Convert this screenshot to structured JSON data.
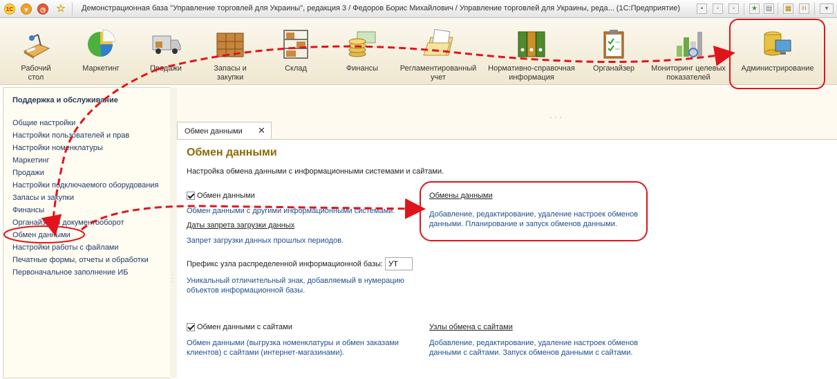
{
  "window": {
    "title": "Демонстрационная база \"Управление торговлей для Украины\", редакция 3 / Федоров Борис Михайлович / Управление торговлей для Украины, реда...  (1С:Предприятие)",
    "logo_text": "1С"
  },
  "sections": [
    {
      "label": "Рабочий\nстол",
      "icon": "desk-icon"
    },
    {
      "label": "Маркетинг",
      "icon": "pie-chart-icon"
    },
    {
      "label": "Продажи",
      "icon": "truck-icon"
    },
    {
      "label": "Запасы и\nзакупки",
      "icon": "boxes-icon"
    },
    {
      "label": "Склад",
      "icon": "warehouse-shelf-icon"
    },
    {
      "label": "Финансы",
      "icon": "coins-icon"
    },
    {
      "label": "Регламентированный\nучет",
      "icon": "folder-report-icon"
    },
    {
      "label": "Нормативно-справочная\nинформация",
      "icon": "binders-icon"
    },
    {
      "label": "Органайзер",
      "icon": "clipboard-icon"
    },
    {
      "label": "Мониторинг целевых\nпоказателей",
      "icon": "bar-chart-icon"
    },
    {
      "label": "Администрирование",
      "icon": "database-computer-icon"
    }
  ],
  "left_panel": {
    "title": "Поддержка и обслуживание",
    "items": [
      "Общие настройки",
      "Настройки пользователей и прав",
      "Настройки номенклатуры",
      "Маркетинг",
      "Продажи",
      "Настройки подключаемого оборудования",
      "Запасы и закупки",
      "Финансы",
      "Органайзер и документооборот",
      "Обмен данными",
      "Настройки работы с файлами",
      "Печатные формы, отчеты и обработки",
      "Первоначальное заполнение ИБ"
    ]
  },
  "tab": {
    "label": "Обмен данными",
    "close": "✕"
  },
  "form": {
    "title": "Обмен данными",
    "subtitle": "Настройка обмена данными с информационными системами и сайтами.",
    "data_exchange_checkbox": "Обмен данными",
    "data_exchange_desc": "Обмен данными с другими информационными системами.",
    "prohibit_dates_link": "Даты запрета загрузки данных",
    "prohibit_dates_desc": "Запрет загрузки данных прошлых периодов.",
    "exchanges_link": "Обмены данными",
    "exchanges_desc": [
      "Добавление, редактирование, удаление настроек обменов",
      "данными. Планирование и запуск обменов данными."
    ],
    "prefix_label": "Префикс узла распределенной информационной базы:",
    "prefix_value": "УТ",
    "prefix_desc": [
      "Уникальный отличительный знак, добавляемый в нумерацию",
      "объектов информационной базы."
    ],
    "sites_checkbox": "Обмен данными с сайтами",
    "sites_desc": [
      "Обмен данными (выгрузка номенклатуры и обмен заказами",
      "клиентов) с сайтами (интернет-магазинами)."
    ],
    "site_nodes_link": "Узлы обмена с сайтами",
    "site_nodes_desc": [
      "Добавление, редактирование, удаление настроек обменов",
      "данными с сайтами. Запуск обменов данными с сайтами."
    ]
  },
  "colors": {
    "annotation": "#e0141c",
    "title": "#8a6b06",
    "description": "#1d4f8c",
    "nav": "#1f3a6b"
  }
}
